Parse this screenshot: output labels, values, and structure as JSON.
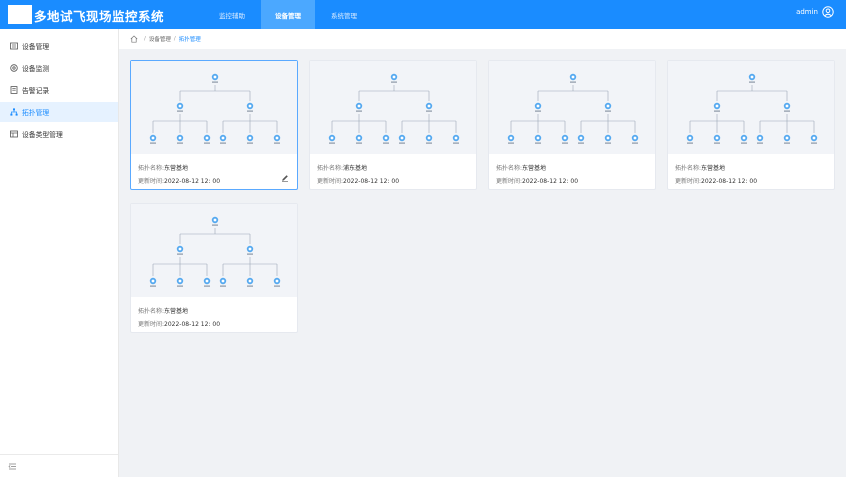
{
  "header": {
    "title": "多地试飞现场监控系统",
    "nav": [
      "监控辅助",
      "设备管理",
      "系统管理"
    ],
    "active_nav": "设备管理",
    "user": "admin"
  },
  "sidebar": {
    "items": [
      {
        "label": "设备管理",
        "icon": "device-icon"
      },
      {
        "label": "设备监测",
        "icon": "monitor-icon"
      },
      {
        "label": "告警记录",
        "icon": "alarm-record-icon"
      },
      {
        "label": "拓扑管理",
        "icon": "topology-icon"
      },
      {
        "label": "设备类型管理",
        "icon": "device-type-icon"
      }
    ],
    "active": "拓扑管理"
  },
  "breadcrumb": [
    "设备管理",
    "拓扑管理"
  ],
  "cards": [
    {
      "name_key": "拓扑名称:",
      "name": "东营基地",
      "time_key": "更新时间:",
      "time": "2022-08-12 12: 00"
    },
    {
      "name_key": "拓扑名称:",
      "name": "浦东基地",
      "time_key": "更新时间:",
      "time": "2022-08-12 12: 00"
    },
    {
      "name_key": "拓扑名称:",
      "name": "东营基地",
      "time_key": "更新时间:",
      "time": "2022-08-12 12: 00"
    },
    {
      "name_key": "拓扑名称:",
      "name": "东营基地",
      "time_key": "更新时间:",
      "time": "2022-08-12 12: 00"
    },
    {
      "name_key": "拓扑名称:",
      "name": "东营基地",
      "time_key": "更新时间:",
      "time": "2022-08-12 12: 00"
    }
  ],
  "colors": {
    "primary": "#1a8cff",
    "nav_active": "#4ba8ff",
    "node": "#3a9bef"
  }
}
